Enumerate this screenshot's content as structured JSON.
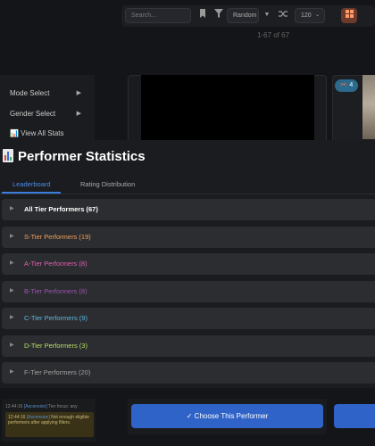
{
  "toolbar": {
    "search_placeholder": "Search...",
    "sort_value": "Random",
    "per_page_value": "120",
    "bookmark_icon": "bookmark-icon",
    "filter_icon": "filter-icon",
    "shuffle_icon": "shuffle-icon",
    "grid_icon": "grid-icon"
  },
  "counter": "1-67 of 67",
  "left_menu": {
    "items": [
      {
        "label": "Mode Select",
        "arrow": "▶"
      },
      {
        "label": "Gender Select",
        "arrow": "▶"
      },
      {
        "label": "📊 View All Stats",
        "arrow": ""
      }
    ]
  },
  "card_badge": "🎮 4",
  "modal": {
    "title": "Performer Statistics",
    "tabs": [
      "Leaderboard",
      "Rating Distribution"
    ],
    "active_tab": "Leaderboard",
    "tiers": [
      {
        "label": "All Tier Performers (67)",
        "color": "#ffffff"
      },
      {
        "label": "S-Tier Performers (19)",
        "color": "#f0a060"
      },
      {
        "label": "A-Tier Performers (8)",
        "color": "#e060b0"
      },
      {
        "label": "B-Tier Performers (8)",
        "color": "#9a55b0"
      },
      {
        "label": "C-Tier Performers (9)",
        "color": "#5fb8e0"
      },
      {
        "label": "D-Tier Performers (3)",
        "color": "#b5e065"
      },
      {
        "label": "F-Tier Performers (20)",
        "color": "#a0a0a0"
      }
    ]
  },
  "log": {
    "line1_time": "12:44:16",
    "line1_tag": "[Ascension]",
    "line1_text": "Tier focus: any",
    "line2_time": "12:44:16",
    "line2_tag": "[Ascension]",
    "line2_text": "Not enough eligible performers after applying filters."
  },
  "choose_button": "✓ Choose This Performer"
}
